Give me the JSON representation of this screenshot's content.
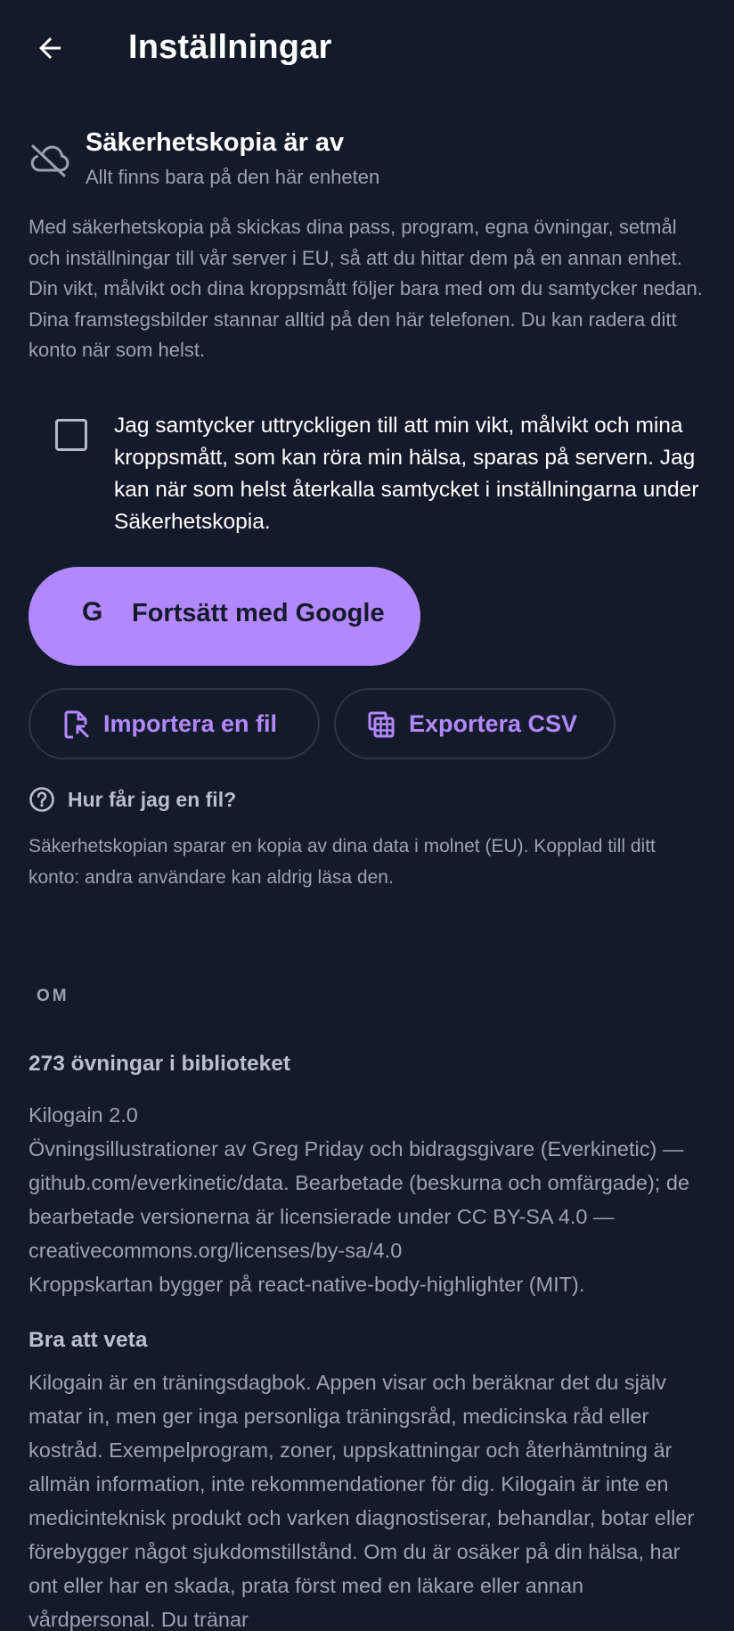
{
  "header": {
    "title": "Inställningar"
  },
  "backup": {
    "status_title": "Säkerhetskopia är av",
    "status_subtitle": "Allt finns bara på den här enheten",
    "description": "Med säkerhetskopia på skickas dina pass, program, egna övningar, setmål och inställningar till vår server i EU, så att du hittar dem på en annan enhet. Din vikt, målvikt och dina kroppsmått följer bara med om du samtycker nedan. Dina framstegsbilder stannar alltid på den här telefonen. Du kan radera ditt konto när som helst.",
    "consent_text": "Jag samtycker uttryckligen till att min vikt, målvikt och mina kroppsmått, som kan röra min hälsa, sparas på servern. Jag kan när som helst återkalla samtycket i inställningarna under Säkerhetskopia.",
    "consent_checked": false,
    "google_button_label": "Fortsätt med Google",
    "google_glyph": "G",
    "import_label": "Importera en fil",
    "export_label": "Exportera CSV",
    "help_label": "Hur får jag en fil?",
    "note": "Säkerhetskopian sparar en kopia av dina data i molnet (EU). Kopplad till ditt konto: andra användare kan aldrig läsa den."
  },
  "about": {
    "section_label": "OM",
    "library_count": "273 övningar i biblioteket",
    "version": "Kilogain 2.0",
    "credits": "Övningsillustrationer av Greg Priday och bidragsgivare (Everkinetic) — github.com/everkinetic/data. Bearbetade (beskurna och omfärgade); de bearbetade versionerna är licensierade under CC BY-SA 4.0 — creativecommons.org/licenses/by-sa/4.0",
    "bodymap": "Kroppskartan bygger på react-native-body-highlighter (MIT).",
    "good_to_know_title": "Bra att veta",
    "disclaimer": "Kilogain är en träningsdagbok. Appen visar och beräknar det du själv matar in, men ger inga personliga träningsråd, medicinska råd eller kostråd. Exempelprogram, zoner, uppskattningar och återhämtning är allmän information, inte rekommendationer för dig. Kilogain är inte en medicinteknisk produkt och varken diagnostiserar, behandlar, botar eller förebygger något sjukdomstillstånd. Om du är osäker på din hälsa, har ont eller har en skada, prata först med en läkare eller annan vårdpersonal. Du tränar"
  },
  "colors": {
    "background": "#131a2a",
    "accent": "#b388ff",
    "muted_text": "#9aa2b4"
  },
  "icons": {
    "back": "arrow-left-icon",
    "cloud": "cloud-off-icon",
    "import": "file-import-icon",
    "export": "spreadsheet-icon",
    "help": "help-circle-icon"
  }
}
